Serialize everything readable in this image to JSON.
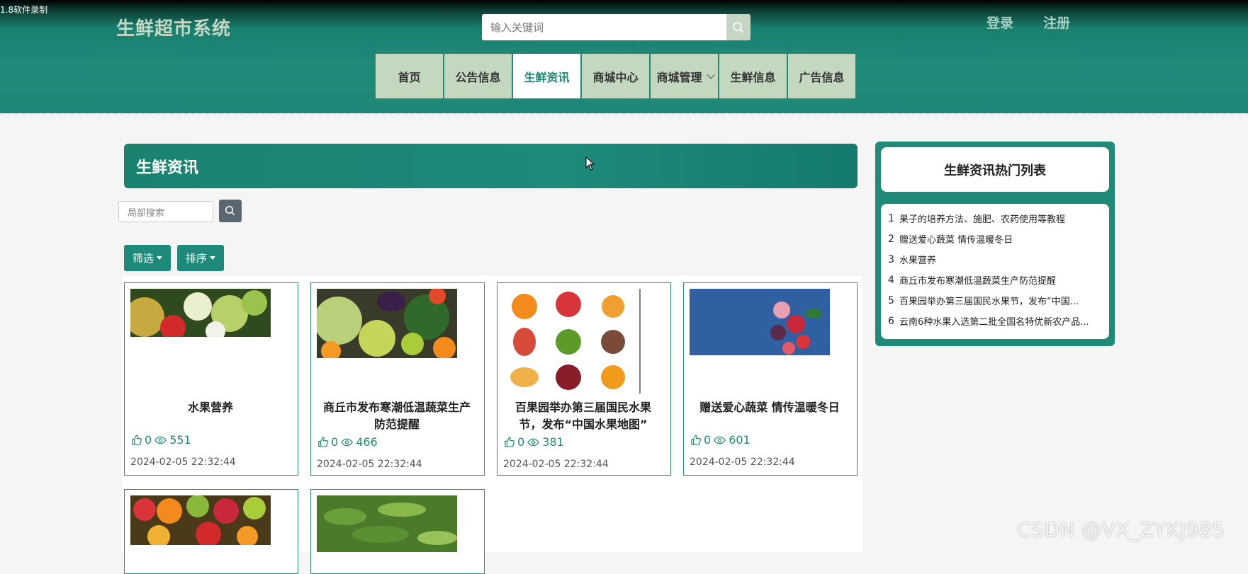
{
  "recorder_label": "1.8软件录制",
  "header": {
    "site_title": "生鲜超市系统",
    "search_placeholder": "输入关键词",
    "login": "登录",
    "register": "注册"
  },
  "nav": {
    "items": [
      {
        "label": "首页"
      },
      {
        "label": "公告信息"
      },
      {
        "label": "生鲜资讯"
      },
      {
        "label": "商城中心"
      },
      {
        "label": "商城管理"
      },
      {
        "label": "生鲜信息"
      },
      {
        "label": "广告信息"
      }
    ],
    "active": "生鲜资讯"
  },
  "main": {
    "section_title": "生鲜资讯",
    "local_search_placeholder": "局部搜索",
    "filter_label": "筛选",
    "sort_label": "排序",
    "cards": [
      {
        "title": "水果营养",
        "likes": "0",
        "views": "551",
        "date": "2024-02-05 22:32:44"
      },
      {
        "title": "商丘市发布寒潮低温蔬菜生产防范提醒",
        "likes": "0",
        "views": "466",
        "date": "2024-02-05 22:32:44"
      },
      {
        "title": "百果园举办第三届国民水果节，发布“中国水果地图”",
        "likes": "0",
        "views": "381",
        "date": "2024-02-05 22:32:44"
      },
      {
        "title": "赠送爱心蔬菜 情传温暖冬日",
        "likes": "0",
        "views": "601",
        "date": "2024-02-05 22:32:44"
      }
    ]
  },
  "sidebar": {
    "title": "生鲜资讯热门列表",
    "items": [
      {
        "num": "1",
        "text": "果子的培养方法、施肥、农药使用等教程"
      },
      {
        "num": "2",
        "text": "赠送爱心蔬菜 情传温暖冬日"
      },
      {
        "num": "3",
        "text": "水果营养"
      },
      {
        "num": "4",
        "text": "商丘市发布寒潮低温蔬菜生产防范提醒"
      },
      {
        "num": "5",
        "text": "百果园举办第三届国民水果节，发布“中国..."
      },
      {
        "num": "6",
        "text": "云南6种水果入选第二批全国名特优新农产品..."
      }
    ]
  },
  "watermark": "CSDN @VX_ZYKJ985",
  "colors": {
    "primary": "#1f8a78",
    "nav_bg": "#c4d8c0",
    "title_color": "#c6d8c3"
  }
}
